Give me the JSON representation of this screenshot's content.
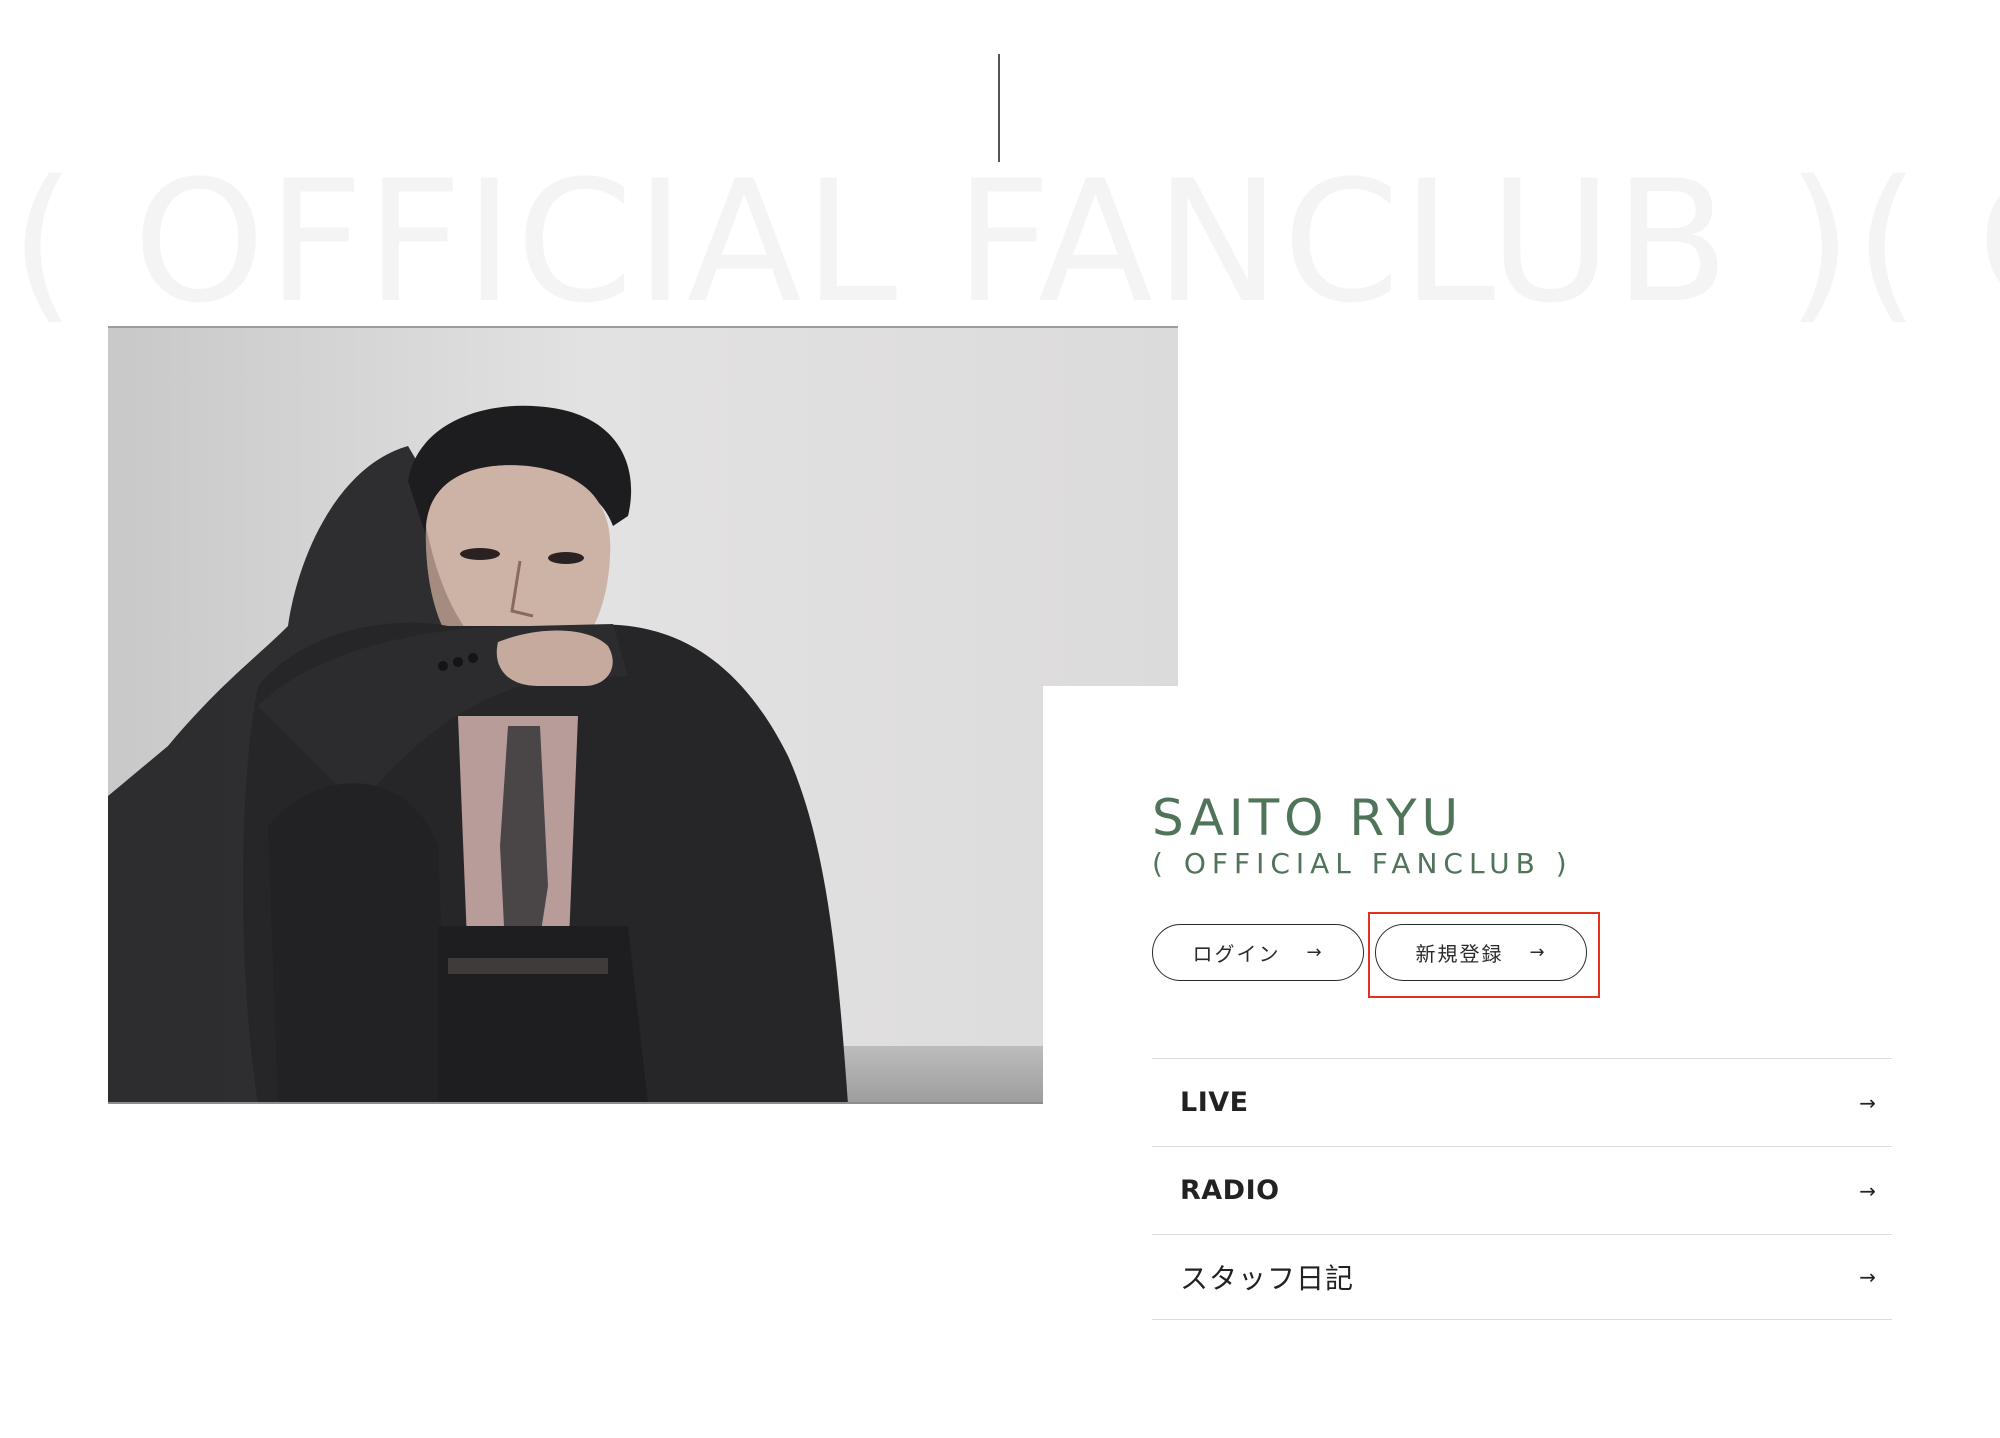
{
  "background_text": "( OFFICIAL FANCLUB )( OFFICIAL FANCLUB )",
  "hero_image": {
    "alt": "man in dark suit sitting against a wall"
  },
  "brand": {
    "name": "SAITO RYU",
    "subtitle": "( OFFICIAL FANCLUB )",
    "accent_color": "#4f7459"
  },
  "buttons": {
    "login_label": "ログイン",
    "register_label": "新規登録",
    "arrow": "→",
    "highlight_color": "#e0321f"
  },
  "menu": {
    "items": [
      {
        "label": "LIVE",
        "arrow": "→"
      },
      {
        "label": "RADIO",
        "arrow": "→"
      },
      {
        "label": "スタッフ日記",
        "arrow": "→"
      }
    ]
  }
}
